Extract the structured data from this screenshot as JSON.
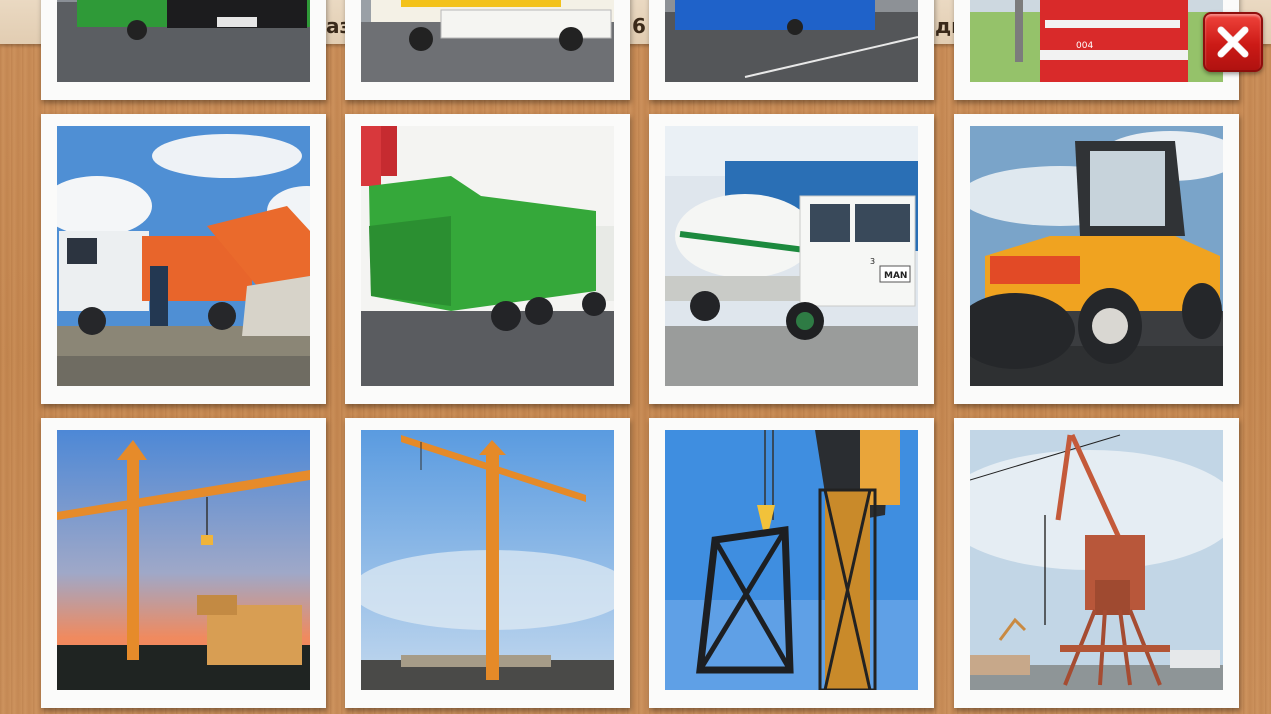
{
  "header_strip": {
    "fragments": [
      {
        "text": "аз",
        "side": "left"
      },
      {
        "text": "6",
        "side": "mid"
      },
      {
        "text": "дн",
        "side": "right"
      }
    ]
  },
  "close_button": {
    "icon": "close-icon",
    "color": "#d9241f"
  },
  "cards": [
    {
      "subject": "city bus green",
      "icon": "bus-icon",
      "tram_number": ""
    },
    {
      "subject": "bus white yellow",
      "icon": "bus-icon",
      "tram_number": ""
    },
    {
      "subject": "bus blue",
      "icon": "bus-icon",
      "tram_number": ""
    },
    {
      "subject": "tram red",
      "icon": "tram-icon",
      "tram_number": "004"
    },
    {
      "subject": "garbage truck orange",
      "icon": "garbage-truck-icon"
    },
    {
      "subject": "garbage truck green",
      "icon": "garbage-truck-icon"
    },
    {
      "subject": "concrete mixer truck",
      "icon": "concrete-mixer-icon",
      "cab_number": "3",
      "brand": "MAN"
    },
    {
      "subject": "road roller",
      "icon": "road-roller-icon"
    },
    {
      "subject": "tower crane sunset",
      "icon": "tower-crane-icon"
    },
    {
      "subject": "tower crane orange",
      "icon": "tower-crane-icon"
    },
    {
      "subject": "crane erecting section",
      "icon": "tower-crane-icon"
    },
    {
      "subject": "harbor crane",
      "icon": "harbor-crane-icon"
    }
  ]
}
